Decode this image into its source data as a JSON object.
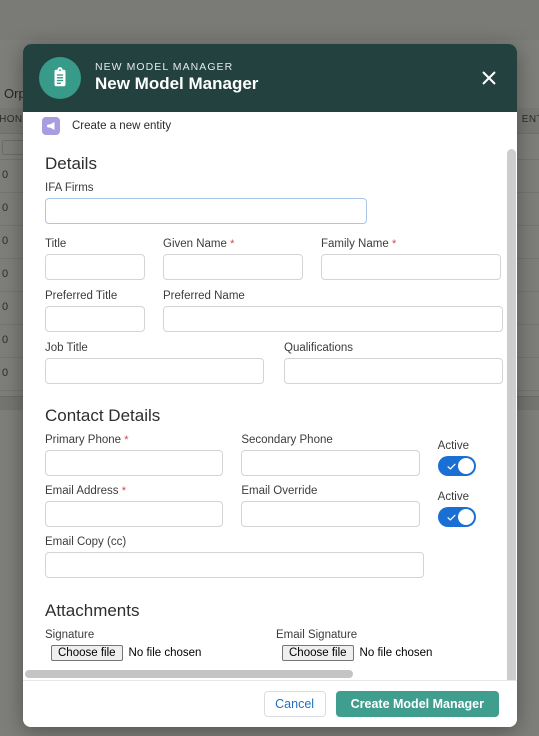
{
  "background": {
    "page_title": "Orphaned Clients",
    "column_header_left": "PHONE",
    "column_header_right": "ENT",
    "rows": [
      "0",
      "0",
      "0",
      "0",
      "0",
      "0",
      "0"
    ]
  },
  "modal": {
    "header": {
      "eyebrow": "NEW MODEL MANAGER",
      "title": "New Model Manager",
      "avatar_icon": "clipboard-list-icon",
      "close_icon": "close-icon"
    },
    "entity_bar": {
      "icon": "megaphone-icon",
      "label": "Create a new entity"
    },
    "details": {
      "section_title": "Details",
      "ifa_firms": {
        "label": "IFA Firms",
        "value": ""
      },
      "title": {
        "label": "Title",
        "value": ""
      },
      "given_name": {
        "label": "Given Name",
        "required": "*",
        "value": ""
      },
      "family_name": {
        "label": "Family Name",
        "required": "*",
        "value": ""
      },
      "preferred_title": {
        "label": "Preferred Title",
        "value": ""
      },
      "preferred_name": {
        "label": "Preferred Name",
        "value": ""
      },
      "job_title": {
        "label": "Job Title",
        "value": ""
      },
      "qualifications": {
        "label": "Qualifications",
        "value": ""
      }
    },
    "contact": {
      "section_title": "Contact Details",
      "primary_phone": {
        "label": "Primary Phone",
        "required": "*",
        "value": ""
      },
      "secondary_phone": {
        "label": "Secondary Phone",
        "value": ""
      },
      "phone_active": {
        "label": "Active",
        "state": "on"
      },
      "email_address": {
        "label": "Email Address",
        "required": "*",
        "value": ""
      },
      "email_override": {
        "label": "Email Override",
        "value": ""
      },
      "email_active": {
        "label": "Active",
        "state": "on"
      },
      "email_copy": {
        "label": "Email Copy (cc)",
        "value": ""
      }
    },
    "attachments": {
      "section_title": "Attachments",
      "signature": {
        "label": "Signature",
        "button": "Choose file",
        "status": "No file chosen"
      },
      "email_signature": {
        "label": "Email Signature",
        "button": "Choose file",
        "status": "No file chosen"
      }
    },
    "footer": {
      "cancel_label": "Cancel",
      "submit_label": "Create Model Manager"
    }
  },
  "colors": {
    "header_bg": "#23413f",
    "avatar_bg": "#389b8a",
    "primary_button": "#3f9e8e",
    "toggle_on": "#1a6fd4",
    "required_star": "#d8424a",
    "link_blue": "#1f6fc4",
    "entity_icon_bg": "#a99de0"
  }
}
